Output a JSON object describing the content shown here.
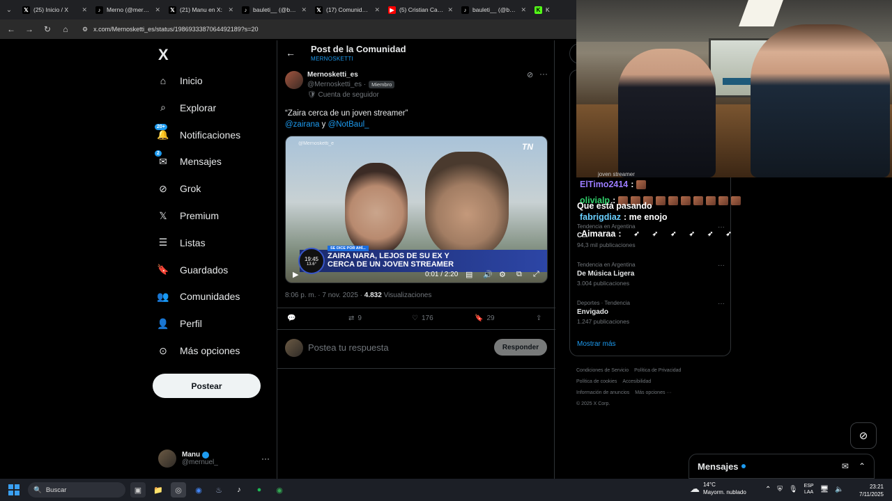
{
  "browser": {
    "tabs": [
      {
        "label": "(25) Inicio / X",
        "icon": "x-icon",
        "color": "#000000"
      },
      {
        "label": "Merno (@mernuel",
        "icon": "tiktok-icon",
        "color": "#000000"
      },
      {
        "label": "(21) Manu en X: ",
        "icon": "x-icon",
        "color": "#000000"
      },
      {
        "label": "bauleti__ (@baulet",
        "icon": "tiktok-icon",
        "color": "#000000"
      },
      {
        "label": "(17) Comunidad M",
        "icon": "x-icon",
        "color": "#000000"
      },
      {
        "label": "(5) Cristian Castro",
        "icon": "youtube-icon",
        "color": "#ff0000"
      },
      {
        "label": "bauleti__ (@baule",
        "icon": "tiktok-icon",
        "color": "#000000"
      },
      {
        "label": "K",
        "icon": "kick-icon",
        "color": "#53fc18"
      }
    ],
    "url": "x.com/Mernosketti_es/status/1986933387064492189?s=20"
  },
  "sidebar": {
    "logo": "X",
    "items": [
      {
        "label": "Inicio",
        "icon": "home-icon"
      },
      {
        "label": "Explorar",
        "icon": "search-icon"
      },
      {
        "label": "Notificaciones",
        "icon": "bell-icon",
        "badge": "20+"
      },
      {
        "label": "Mensajes",
        "icon": "envelope-icon",
        "badge": "2"
      },
      {
        "label": "Grok",
        "icon": "grok-icon"
      },
      {
        "label": "Premium",
        "icon": "x-premium-icon"
      },
      {
        "label": "Listas",
        "icon": "list-icon"
      },
      {
        "label": "Guardados",
        "icon": "bookmark-icon"
      },
      {
        "label": "Comunidades",
        "icon": "communities-icon"
      },
      {
        "label": "Perfil",
        "icon": "person-icon"
      },
      {
        "label": "Más opciones",
        "icon": "more-circle-icon"
      }
    ],
    "post_button": "Postear",
    "user": {
      "name": "Manu",
      "handle": "@mernuel_",
      "more": "···"
    }
  },
  "main": {
    "title": "Post de la Comunidad",
    "subtitle": "MERNOSKETTI",
    "tweet": {
      "author": "Mernosketti_es",
      "handle": "@Mernosketti_es ·",
      "member_badge": "Miembro",
      "follower_account": "Cuenta de seguidor",
      "text_line1": "“Zaira cerca de un joven streamer”",
      "mention1": "@zairana",
      "conj": "y",
      "mention2": "@NotBaul_",
      "video": {
        "watermark": "@Mernosketti_e",
        "channel": "TN",
        "lower_tag": "SE DICE POR AHÍ...",
        "headline_line1": "ZAIRA NARA, LEJOS DE SU EX Y",
        "headline_line2": "CERCA DE UN JOVEN STREAMER",
        "clock_time": "19:45",
        "clock_temp": "13.6°",
        "time": "0:01 / 2:20"
      },
      "timestamp": "8:06 p. m. · 7 nov. 2025 ·",
      "views": "4.832",
      "views_label": "Visualizaciones",
      "retweets": "9",
      "likes": "176",
      "bookmarks": "29"
    },
    "reply_placeholder": "Postea tu respuesta",
    "reply_button": "Responder"
  },
  "trends": {
    "items": [
      {
        "context": "Tendencia en Argentina",
        "name": "C...",
        "count": "94,3 mil publicaciones"
      },
      {
        "context": "Tendencia en Argentina",
        "name": "De Música Ligera",
        "count": "3.004 publicaciones"
      },
      {
        "context": "Deportes · Tendencia",
        "name": "Envigado",
        "count": "1.247 publicaciones"
      }
    ],
    "show_more": "Mostrar más"
  },
  "footer": {
    "links": [
      "Condiciones de Servicio",
      "Política de Privacidad",
      "Política de cookies",
      "Accesibilidad",
      "Información de anuncios",
      "Más opciones ···"
    ],
    "copyright": "© 2025 X Corp."
  },
  "chat_overlay": {
    "partial": "joven streamer",
    "lines": [
      {
        "user": "ElTimo2414",
        "color": "#9b7cff",
        "text": ":"
      },
      {
        "user": "olivialp",
        "color": "#2fd06a",
        "text": ":"
      },
      {
        "user": "",
        "color": "#ffffff",
        "text": "Que está pasando"
      },
      {
        "user": "fabrigdiaz",
        "color": "#6ad0ff",
        "text": ": me enojo"
      },
      {
        "user": "Aimaraa",
        "color": "#ffffff",
        "text": ":"
      }
    ]
  },
  "dm": {
    "title": "Mensajes"
  },
  "taskbar": {
    "search": "Buscar",
    "weather_temp": "14°C",
    "weather_desc": "Mayorm. nublado",
    "lang1": "ESP",
    "lang2": "LAA",
    "time": "23:21",
    "date": "7/11/2025"
  }
}
